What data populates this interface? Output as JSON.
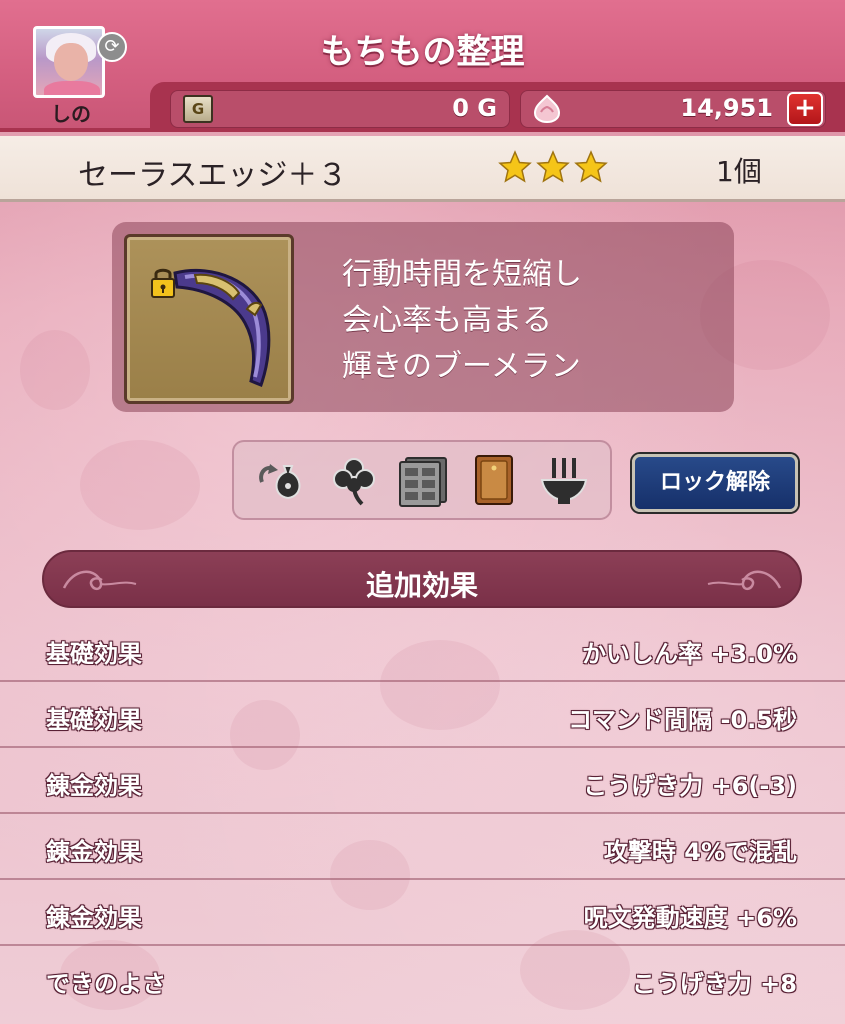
{
  "header": {
    "title": "もちもの整理",
    "player_name": "しの",
    "gold": "0 G",
    "gold_icon_letter": "G",
    "gems": "14,951",
    "add_gems_symbol": "+"
  },
  "item": {
    "name": "セーラスエッジ＋３",
    "stars": 3,
    "count": "1個",
    "locked": true,
    "description": [
      "行動時間を短縮し",
      "会心率も高まる",
      "輝きのブーメラン"
    ]
  },
  "actions": {
    "icons": [
      "sell-bag-icon",
      "clover-icon",
      "storage-cabinet-icon",
      "book-icon",
      "alchemy-pot-icon"
    ],
    "unlock_label": "ロック解除"
  },
  "effects": {
    "section_title": "追加効果",
    "rows": [
      {
        "label": "基礎効果",
        "value": "かいしん率  +3.0%"
      },
      {
        "label": "基礎効果",
        "value": "コマンド間隔  -0.5秒"
      },
      {
        "label": "錬金効果",
        "value": "こうげき力  +6(-3)"
      },
      {
        "label": "錬金効果",
        "value": "攻撃時  4%で混乱"
      },
      {
        "label": "錬金効果",
        "value": "呪文発動速度  +6%"
      },
      {
        "label": "できのよさ",
        "value": "こうげき力  +8"
      }
    ]
  },
  "colors": {
    "header": "#d45f80",
    "accent_dark": "#a8334f",
    "unlock_button": "#1f3d7a",
    "star": "#f5c518"
  }
}
